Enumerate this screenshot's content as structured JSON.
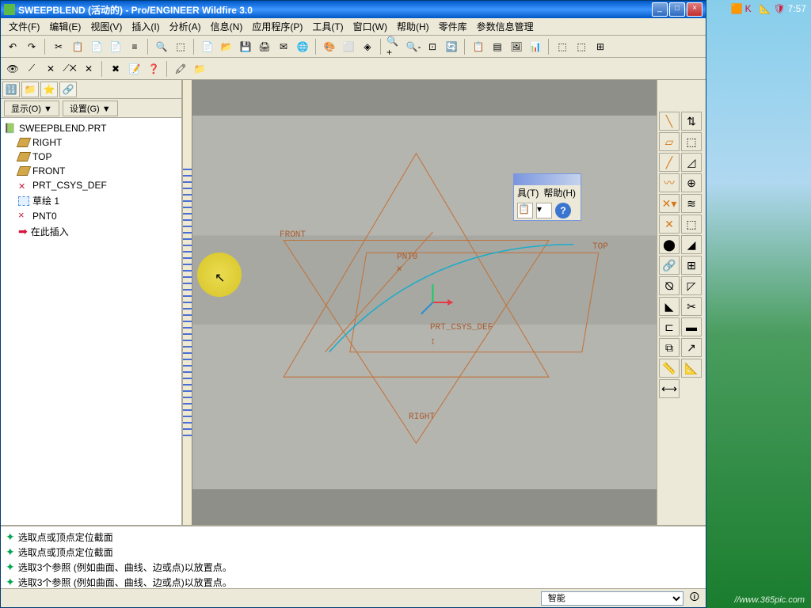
{
  "taskbar": {
    "time": "7:57"
  },
  "titlebar": {
    "text": "SWEEPBLEND (活动的) - Pro/ENGINEER Wildfire 3.0"
  },
  "menubar": [
    "文件(F)",
    "编辑(E)",
    "视图(V)",
    "插入(I)",
    "分析(A)",
    "信息(N)",
    "应用程序(P)",
    "工具(T)",
    "窗口(W)",
    "帮助(H)",
    "零件库",
    "参数信息管理"
  ],
  "filters": {
    "display": "显示(O) ▼",
    "settings": "设置(G) ▼"
  },
  "tree": {
    "root": "SWEEPBLEND.PRT",
    "items": [
      {
        "icon": "plane",
        "label": "RIGHT"
      },
      {
        "icon": "plane",
        "label": "TOP"
      },
      {
        "icon": "plane",
        "label": "FRONT"
      },
      {
        "icon": "csys",
        "label": "PRT_CSYS_DEF"
      },
      {
        "icon": "sketch",
        "label": "草绘 1"
      },
      {
        "icon": "point",
        "label": "PNT0"
      },
      {
        "icon": "insert",
        "label": "在此插入"
      }
    ]
  },
  "viewport": {
    "labels": {
      "front": "FRONT",
      "top": "TOP",
      "right": "RIGHT",
      "csys": "PRT_CSYS_DEF",
      "pnt": "PNT0"
    }
  },
  "float": {
    "menu1": "具(T)",
    "menu2": "帮助(H)"
  },
  "messages": [
    "选取点或顶点定位截面",
    "选取点或顶点定位截面",
    "选取3个参照 (例如曲面、曲线、边或点)以放置点。",
    "选取3个参照 (例如曲面、曲线、边或点)以放置点。"
  ],
  "statusbar": {
    "mode": "智能"
  },
  "watermark": "//www.365pic.com"
}
